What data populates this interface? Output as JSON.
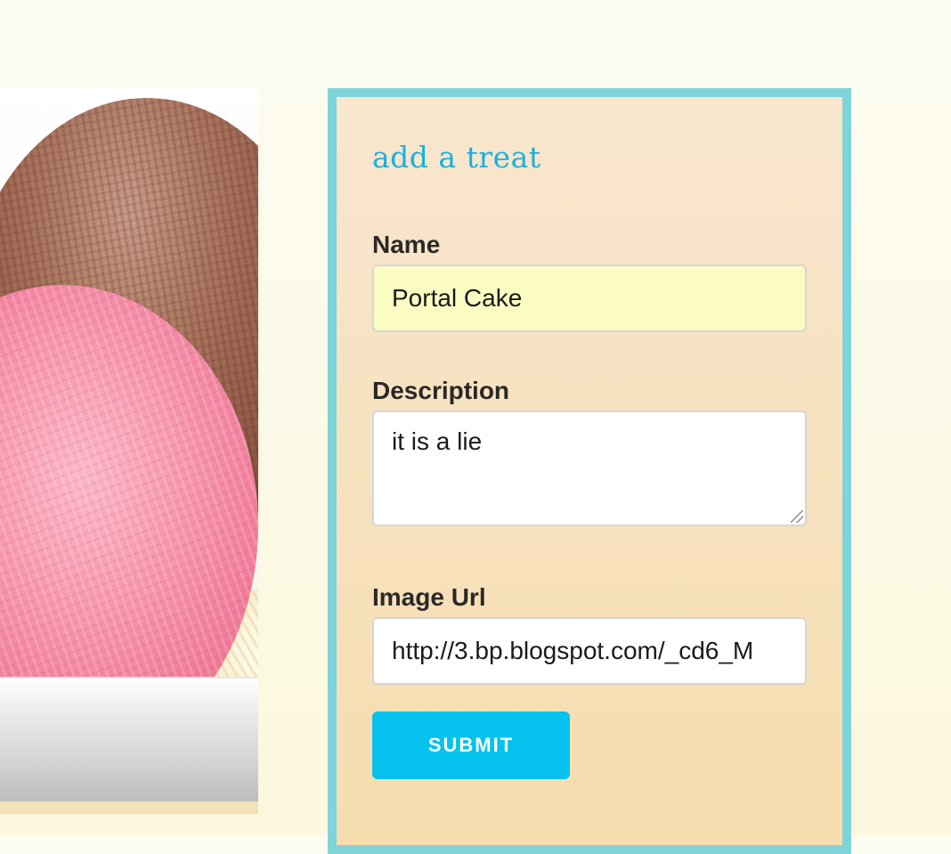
{
  "hero": {
    "image": "ice-cream-photo"
  },
  "form": {
    "title": "add a treat",
    "name_label": "Name",
    "name_value": "Portal Cake",
    "description_label": "Description",
    "description_value": "it is a lie",
    "image_label": "Image Url",
    "image_value": "http://3.bp.blogspot.com/_cd6_M",
    "submit_label": "SUBMIT"
  },
  "colors": {
    "panel_border": "#7fd4d9",
    "title": "#18b2dd",
    "submit_button": "#05c1ed",
    "name_field_bg": "#fbfcc2"
  }
}
